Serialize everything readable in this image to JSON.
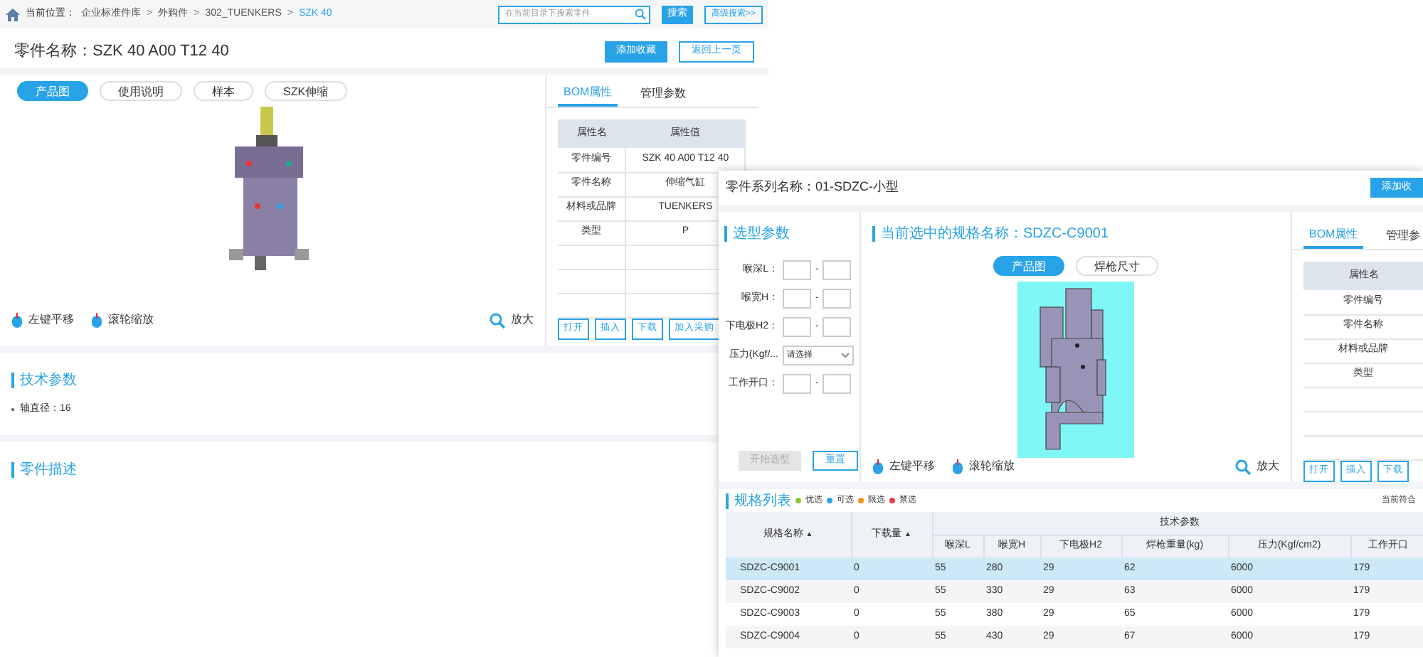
{
  "part_window": {
    "breadcrumb": {
      "label": "当前位置：",
      "items": [
        {
          "text": "企业标准件库",
          "selected": false
        },
        {
          "text": "外购件",
          "selected": false
        },
        {
          "text": "302_TUENKERS",
          "selected": false
        },
        {
          "text": "SZK 40",
          "selected": true
        }
      ],
      "separator": ">"
    },
    "search": {
      "placeholder": "在当前目录下搜索零件",
      "button": "搜索",
      "advanced": "高级搜索>>"
    },
    "title": "零件名称：SZK 40 A00 T12 40",
    "actions": [
      "添加收藏",
      "返回上一页"
    ],
    "view_tabs": [
      {
        "label": "产品图",
        "selected": true
      },
      {
        "label": "使用说明",
        "selected": false
      },
      {
        "label": "样本",
        "selected": false
      },
      {
        "label": "SZK伸缩",
        "selected": false
      }
    ],
    "viewer_hints": [
      "左键平移",
      "滚轮缩放"
    ],
    "zoom": "放大",
    "property_tabs": [
      {
        "label": "BOM属性",
        "selected": true
      },
      {
        "label": "管理参数",
        "selected": false
      }
    ],
    "property_table": {
      "columns": [
        "属性名",
        "属性值"
      ],
      "rows": [
        [
          "零件编号",
          "SZK 40 A00 T12 40"
        ],
        [
          "零件名称",
          "伸缩气缸"
        ],
        [
          "材料或品牌",
          "TUENKERS"
        ],
        [
          "类型",
          "P"
        ]
      ]
    },
    "buttons": [
      "打开",
      "插入",
      "下载",
      "加入采购"
    ],
    "sections": [
      {
        "title": "技术参数",
        "items": [
          "轴直径：16"
        ]
      },
      {
        "title": "零件描述"
      }
    ]
  },
  "series_window": {
    "title": "零件系列名称：01-SDZC-小型",
    "action": "添加收",
    "filter": {
      "title": "选型参数",
      "separator": "-",
      "fields": [
        {
          "kind": "range",
          "label": "喉深L："
        },
        {
          "kind": "range",
          "label": "喉宽H："
        },
        {
          "kind": "range",
          "label": "下电极H2："
        },
        {
          "kind": "select",
          "label": "压力(Kgf/...",
          "placeholder": "请选择"
        },
        {
          "kind": "range",
          "label": "工作开口："
        }
      ],
      "buttons": [
        {
          "label": "开始选型",
          "disabled": true
        },
        {
          "label": "重置",
          "disabled": false
        }
      ]
    },
    "viewer": {
      "title": "当前选中的规格名称：SDZC-C9001",
      "tabs": [
        {
          "label": "产品图",
          "selected": true
        },
        {
          "label": "焊枪尺寸",
          "selected": false
        }
      ],
      "hints": [
        "左键平移",
        "滚轮缩放"
      ],
      "zoom": "放大"
    },
    "property_tabs": [
      {
        "label": "BOM属性",
        "selected": true
      },
      {
        "label": "管理参",
        "selected": false
      }
    ],
    "property_table": {
      "columns": [
        "属性名"
      ],
      "rows": [
        [
          "零件编号"
        ],
        [
          "零件名称"
        ],
        [
          "材料或品牌"
        ],
        [
          "类型"
        ]
      ]
    },
    "buttons": [
      "打开",
      "插入",
      "下载"
    ],
    "spec_list": {
      "title": "规格列表",
      "legend": [
        {
          "label": "优选",
          "color": "#8cc63f"
        },
        {
          "label": "可选",
          "color": "#29a3e8"
        },
        {
          "label": "限选",
          "color": "#f7941d"
        },
        {
          "label": "禁选",
          "color": "#ee3a43"
        }
      ],
      "note": "当前符合",
      "columns": [
        {
          "label": "规格名称",
          "sort": "▲"
        },
        {
          "label": "下载量",
          "sort": "▲"
        }
      ],
      "group": "技术参数",
      "sub_columns": [
        "喉深L",
        "喉宽H",
        "下电极H2",
        "焊枪重量(kg)",
        "压力(Kgf/cm2)",
        "工作开口"
      ],
      "rows": [
        {
          "selected": true,
          "cells": [
            "SDZC-C9001",
            "0",
            "55",
            "280",
            "29",
            "62",
            "6000",
            "179"
          ]
        },
        {
          "selected": false,
          "cells": [
            "SDZC-C9002",
            "0",
            "55",
            "330",
            "29",
            "63",
            "6000",
            "179"
          ]
        },
        {
          "selected": false,
          "cells": [
            "SDZC-C9003",
            "0",
            "55",
            "380",
            "29",
            "65",
            "6000",
            "179"
          ]
        },
        {
          "selected": false,
          "cells": [
            "SDZC-C9004",
            "0",
            "55",
            "430",
            "29",
            "67",
            "6000",
            "179"
          ]
        }
      ]
    }
  }
}
